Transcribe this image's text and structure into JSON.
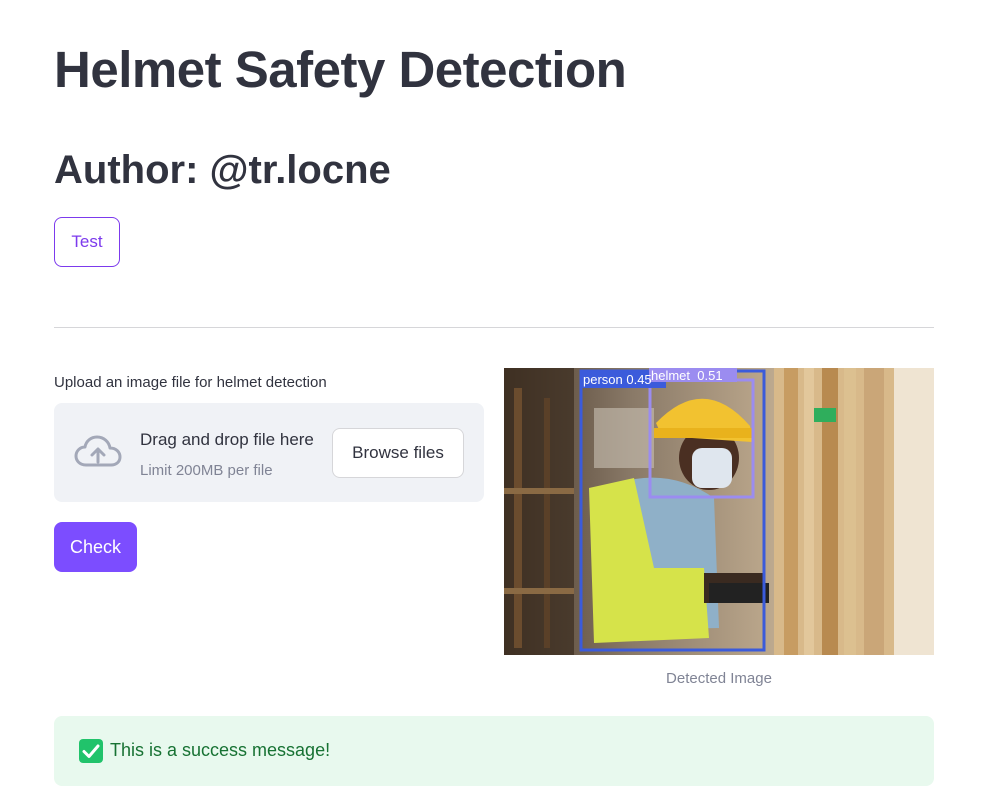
{
  "page": {
    "title": "Helmet Safety Detection",
    "author": "Author: @tr.locne"
  },
  "buttons": {
    "test": "Test",
    "browse": "Browse files",
    "check": "Check"
  },
  "uploader": {
    "label": "Upload an image file for helmet detection",
    "drop_text": "Drag and drop file here",
    "limit_text": "Limit 200MB per file",
    "icon": "cloud-upload-icon"
  },
  "result": {
    "caption": "Detected Image",
    "detections": [
      {
        "label": "person 0.45"
      },
      {
        "label": "helmet  0.51"
      }
    ]
  },
  "alert": {
    "message": "This is a success message!",
    "icon": "check-box-icon"
  },
  "colors": {
    "primary": "#7c4dff",
    "text": "#31333f",
    "success_bg": "#e8f9ee",
    "success_text": "#177233",
    "person_box": "#3b5bdb",
    "helmet_box": "#9b8cf0"
  }
}
